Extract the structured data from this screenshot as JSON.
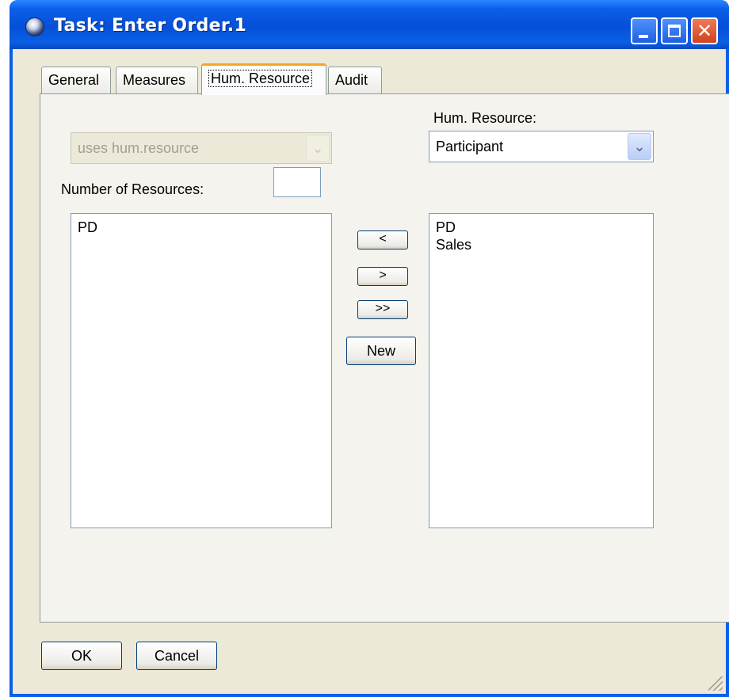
{
  "window": {
    "title": "Task: Enter Order.1",
    "title_icon": "app-globe-icon",
    "colors": {
      "titlebar": "#0550d8",
      "client": "#ece9d8",
      "active_tab_accent": "#f5a623"
    }
  },
  "tabs": [
    {
      "label": "General",
      "active": false
    },
    {
      "label": "Measures",
      "active": false
    },
    {
      "label": "Hum. Resource",
      "active": true
    },
    {
      "label": "Audit",
      "active": false
    }
  ],
  "panel": {
    "uses_combo": {
      "value": "uses hum.resource",
      "enabled": false
    },
    "number_label": "Number of Resources:",
    "number_value": "",
    "hum_resource_label": "Hum. Resource:",
    "hum_resource_combo": {
      "value": "Participant"
    },
    "left_list": [
      "PD"
    ],
    "right_list": [
      "PD",
      "Sales"
    ],
    "move_left_label": "<",
    "move_right_label": ">",
    "move_all_right_label": ">>",
    "new_label": "New"
  },
  "footer": {
    "ok_label": "OK",
    "cancel_label": "Cancel"
  }
}
